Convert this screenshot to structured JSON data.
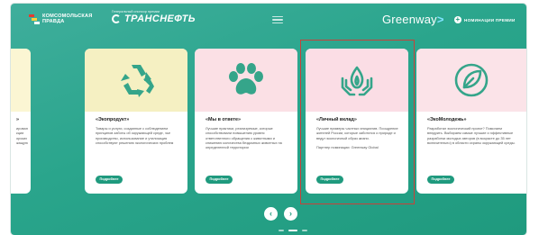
{
  "header": {
    "kp_logo_line1": "КОМСОМОЛЬСКАЯ",
    "kp_logo_line2": "ПРАВДА",
    "partner_caption": "Генеральный спонсор премии",
    "partner_name": "ТРАНСНЕФТЬ",
    "brand": "Greenway",
    "brand_arrow": ">",
    "nominations_label": "НОМИНАЦИИ ПРЕМИИ"
  },
  "cards": [
    {
      "title": "»",
      "desc": "ирован\nкции\nорских\nжащую",
      "button": ""
    },
    {
      "title": "«Экопродукт»",
      "desc": "Товары и услуги, созданные с соблюдением принципов заботы об окружающей среде, чье производство, использование и утилизация способствуют решению экологических проблем",
      "button": "Подробнее",
      "icon": "recycle-icon"
    },
    {
      "title": "«Мы в ответе»",
      "desc": "Лучшие практики, реализуемые, которые способствовали повышению уровня ответственного обращения с животными и снижению количества бездомных животных на определенной территории",
      "button": "Подробнее",
      "icon": "paw-icon"
    },
    {
      "title": "«Личный вклад»",
      "desc": "Лучшие примеры частных инициатив. Поощрение жителей России, которые заботятся о природе и ведут экологичный образ жизни.",
      "partner": "Партнер номинации: Greenway Global",
      "button": "Подробнее",
      "icon": "hands-flame-icon"
    },
    {
      "title": "«ЭкоМолодежь»",
      "desc": "Разработал экологический проект? Помогаем внедрить. Выбираем самые лучшие и эффективные разработки молодых авторов (в возрасте до 35 лет включительно) в области охраны окружающей среды.",
      "button": "Подробнее",
      "icon": "leaf-icon"
    }
  ],
  "carousel": {
    "prev": "‹",
    "next": "›"
  },
  "colors": {
    "accent": "#1f9a7e",
    "highlight": "#c8413a"
  }
}
